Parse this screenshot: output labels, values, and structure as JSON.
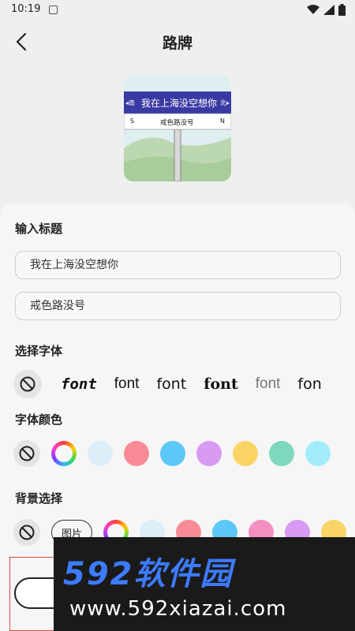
{
  "status": {
    "time": "10:19"
  },
  "header": {
    "title": "路牌"
  },
  "preview": {
    "sign_main": "我在上海没空想你",
    "dir_left": "◂南",
    "dir_right": "北▸",
    "sub_left": "S",
    "sub_text": "戒色路没号",
    "sub_right": "N"
  },
  "title_section": {
    "label": "输入标题",
    "field1_value": "我在上海没空想你",
    "field2_value": "戒色路没号"
  },
  "font_section": {
    "label": "选择字体",
    "fonts": [
      "font",
      "font",
      "font",
      "font",
      "font",
      "fon"
    ]
  },
  "color_section": {
    "label": "字体颜色",
    "swatches": [
      "#dceef8",
      "#f98b96",
      "#5cc8f7",
      "#d89af2",
      "#fbd466",
      "#7ed8bd",
      "#a1ecfa"
    ]
  },
  "bg_section": {
    "label": "背景选择",
    "image_button": "图片",
    "swatches": [
      "#dceef8",
      "#f98b96",
      "#5cc8f7",
      "#f48fc2",
      "#d89af2",
      "#fbd466"
    ]
  },
  "watermark": {
    "brand": "592软件园",
    "url": "www.592xiazai.com"
  }
}
